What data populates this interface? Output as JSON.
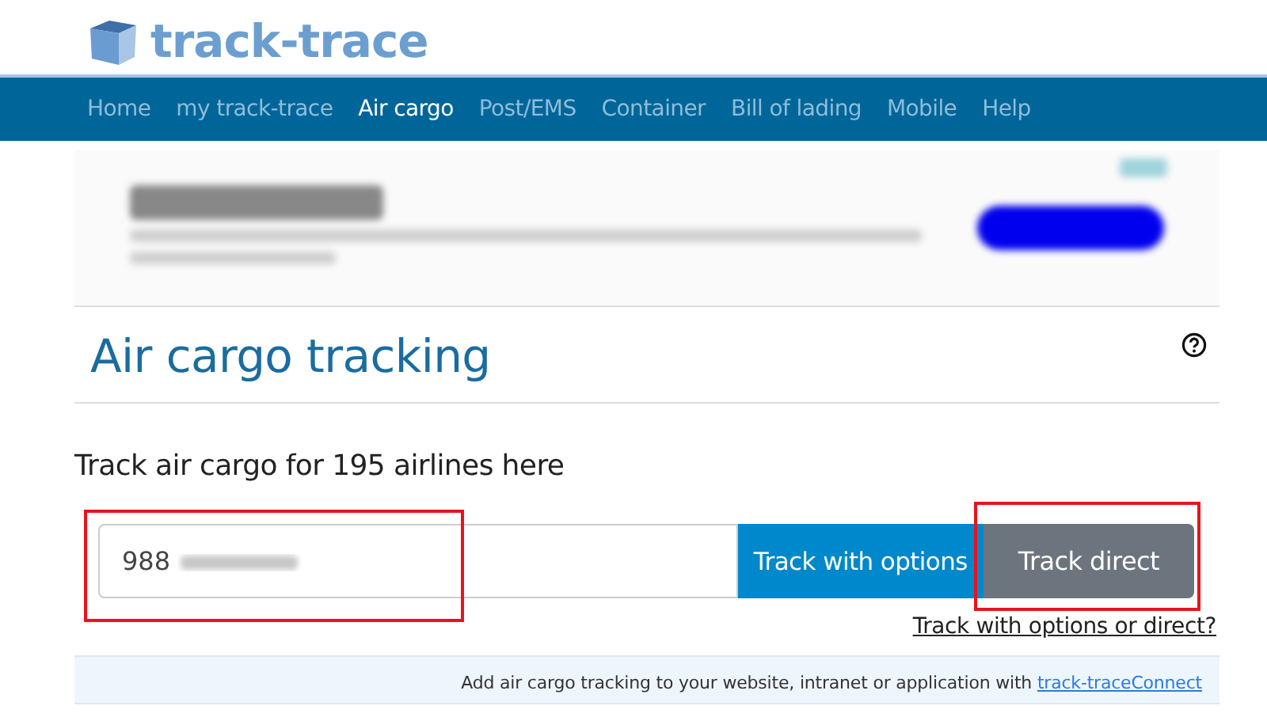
{
  "logo": {
    "text": "track-trace"
  },
  "nav": [
    {
      "label": "Home",
      "selected": false
    },
    {
      "label": "my track-trace",
      "selected": false
    },
    {
      "label": "Air cargo",
      "selected": true
    },
    {
      "label": "Post/EMS",
      "selected": false
    },
    {
      "label": "Container",
      "selected": false
    },
    {
      "label": "Bill of lading",
      "selected": false
    },
    {
      "label": "Mobile",
      "selected": false
    },
    {
      "label": "Help",
      "selected": false
    }
  ],
  "heading": "Air cargo tracking",
  "intro": "Track air cargo for 195 airlines here",
  "tracking": {
    "value": "988",
    "buttons": [
      {
        "label": "Track with options",
        "kind": "primary"
      },
      {
        "label": "Track direct",
        "kind": "secondary"
      }
    ],
    "help_link": "Track with options or direct?"
  },
  "footer": {
    "text": "Add air cargo tracking to your website, intranet or application with ",
    "link": "track-traceConnect"
  }
}
